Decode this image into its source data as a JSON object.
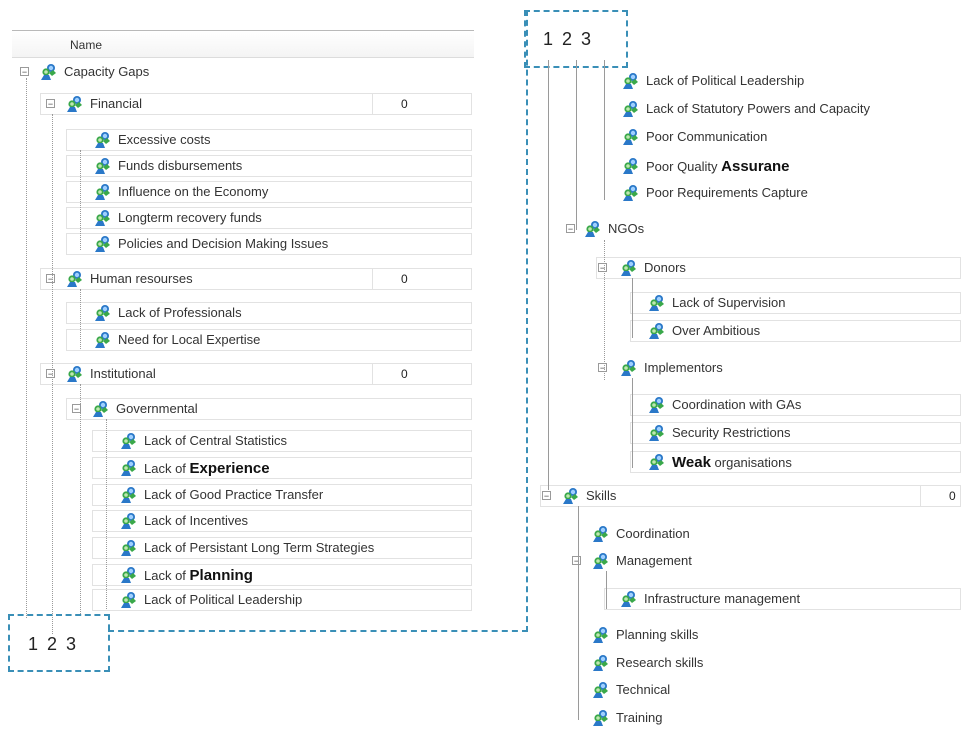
{
  "left_panel": {
    "header": "Name",
    "pager": "1 2 3",
    "rows": [
      {
        "label": "Capacity Gaps"
      },
      {
        "label": "Financial",
        "count": "0"
      },
      {
        "label": "Excessive costs"
      },
      {
        "label": "Funds disbursements"
      },
      {
        "label": "Influence on the Economy"
      },
      {
        "label": "Longterm recovery funds"
      },
      {
        "label": "Policies and Decision Making Issues"
      },
      {
        "label": "Human resourses",
        "count": "0"
      },
      {
        "label": "Lack of Professionals"
      },
      {
        "label": "Need for Local Expertise"
      },
      {
        "label": "Institutional",
        "count": "0"
      },
      {
        "label": "Governmental"
      },
      {
        "label": "Lack of Central Statistics"
      },
      {
        "label_prefix": "Lack of ",
        "label_bold": "Experience"
      },
      {
        "label": "Lack of Good Practice Transfer"
      },
      {
        "label": "Lack of Incentives"
      },
      {
        "label": "Lack of Persistant Long Term Strategies"
      },
      {
        "label_prefix": "Lack of ",
        "label_bold": "Planning"
      },
      {
        "label": "Lack of Political Leadership"
      }
    ]
  },
  "right_panel": {
    "pager": "1 2 3",
    "rows": [
      {
        "label": "Lack of Political Leadership"
      },
      {
        "label": "Lack of Statutory Powers and Capacity"
      },
      {
        "label": "Poor Communication"
      },
      {
        "label_prefix": "Poor Quality ",
        "label_bold": "Assurane"
      },
      {
        "label": "Poor Requirements Capture"
      },
      {
        "label": "NGOs"
      },
      {
        "label": "Donors"
      },
      {
        "label": "Lack of Supervision"
      },
      {
        "label": "Over Ambitious"
      },
      {
        "label": "Implementors"
      },
      {
        "label": "Coordination with GAs"
      },
      {
        "label": "Security Restrictions"
      },
      {
        "label_bold": "Weak",
        "label_suffix": " organisations"
      },
      {
        "label": "Skills",
        "count": "0"
      },
      {
        "label": "Coordination"
      },
      {
        "label": "Management"
      },
      {
        "label": "Infrastructure management"
      },
      {
        "label": "Planning skills"
      },
      {
        "label": "Research skills"
      },
      {
        "label": "Technical"
      },
      {
        "label": "Training"
      }
    ]
  },
  "colors": {
    "dash_border": "#3a8fb7",
    "icon_green": "#3aa84a",
    "icon_blue": "#2a78c8"
  },
  "icons": {
    "tree_node": "group-icon"
  }
}
